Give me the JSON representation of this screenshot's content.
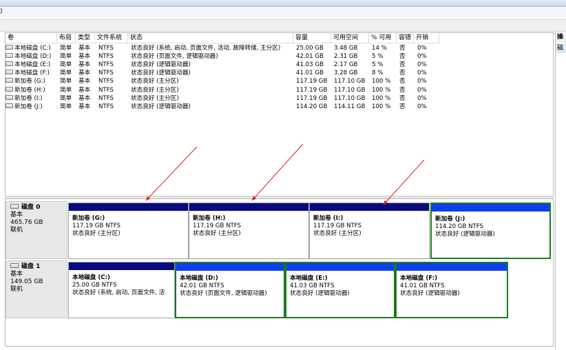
{
  "menu": {
    "first": ")"
  },
  "right_panel": {
    "header": "操作",
    "item": "磁"
  },
  "columns": [
    "卷",
    "布局",
    "类型",
    "文件系统",
    "状态",
    "容量",
    "可用空间",
    "% 可用",
    "容错",
    "开销"
  ],
  "volumes": [
    {
      "name": "本地磁盘 (C:)",
      "layout": "简单",
      "type": "基本",
      "fs": "NTFS",
      "status": "状态良好 (系统, 启动, 页面文件, 活动, 故障转储, 主分区)",
      "capacity": "25.00 GB",
      "free": "3.48 GB",
      "pct": "14 %",
      "fault": "否",
      "overhead": "0%"
    },
    {
      "name": "本地磁盘 (D:)",
      "layout": "简单",
      "type": "基本",
      "fs": "NTFS",
      "status": "状态良好 (页面文件, 逻辑驱动器)",
      "capacity": "42.01 GB",
      "free": "2.31 GB",
      "pct": "5 %",
      "fault": "否",
      "overhead": "0%"
    },
    {
      "name": "本地磁盘 (E:)",
      "layout": "简单",
      "type": "基本",
      "fs": "NTFS",
      "status": "状态良好 (逻辑驱动器)",
      "capacity": "41.03 GB",
      "free": "2.17 GB",
      "pct": "5 %",
      "fault": "否",
      "overhead": "0%"
    },
    {
      "name": "本地磁盘 (F:)",
      "layout": "简单",
      "type": "基本",
      "fs": "NTFS",
      "status": "状态良好 (逻辑驱动器)",
      "capacity": "41.01 GB",
      "free": "3.28 GB",
      "pct": "8 %",
      "fault": "否",
      "overhead": "0%"
    },
    {
      "name": "新加卷 (G:)",
      "layout": "简单",
      "type": "基本",
      "fs": "NTFS",
      "status": "状态良好 (主分区)",
      "capacity": "117.19 GB",
      "free": "117.10 GB",
      "pct": "100 %",
      "fault": "否",
      "overhead": "0%"
    },
    {
      "name": "新加卷 (H:)",
      "layout": "简单",
      "type": "基本",
      "fs": "NTFS",
      "status": "状态良好 (主分区)",
      "capacity": "117.19 GB",
      "free": "117.10 GB",
      "pct": "100 %",
      "fault": "否",
      "overhead": "0%"
    },
    {
      "name": "新加卷 (I:)",
      "layout": "简单",
      "type": "基本",
      "fs": "NTFS",
      "status": "状态良好 (主分区)",
      "capacity": "117.19 GB",
      "free": "117.10 GB",
      "pct": "100 %",
      "fault": "否",
      "overhead": "0%"
    },
    {
      "name": "新加卷 (J:)",
      "layout": "简单",
      "type": "基本",
      "fs": "NTFS",
      "status": "状态良好 (逻辑驱动器)",
      "capacity": "114.20 GB",
      "free": "114.11 GB",
      "pct": "100 %",
      "fault": "否",
      "overhead": "0%"
    }
  ],
  "disks": [
    {
      "name": "磁盘 0",
      "kind": "基本",
      "size": "465.76 GB",
      "state": "联机",
      "partitions": [
        {
          "title": "新加卷  (G:)",
          "size": "117.19 GB NTFS",
          "status": "状态良好 (主分区)",
          "bar": "primary",
          "selected": false
        },
        {
          "title": "新加卷  (H:)",
          "size": "117.19 GB NTFS",
          "status": "状态良好 (主分区)",
          "bar": "primary",
          "selected": false
        },
        {
          "title": "新加卷  (I:)",
          "size": "117.19 GB NTFS",
          "status": "状态良好 (主分区)",
          "bar": "primary",
          "selected": false
        },
        {
          "title": "新加卷  (J:)",
          "size": "114.20 GB NTFS",
          "status": "状态良好 (逻辑驱动器)",
          "bar": "logical",
          "selected": true
        }
      ]
    },
    {
      "name": "磁盘 1",
      "kind": "基本",
      "size": "149.05 GB",
      "state": "联机",
      "partitions": [
        {
          "title": "本地磁盘  (C:)",
          "size": "25.00 GB NTFS",
          "status": "状态良好 (系统, 启动, 页面文件, 活",
          "bar": "primary",
          "selected": false
        },
        {
          "title": "本地磁盘  (D:)",
          "size": "42.01 GB NTFS",
          "status": "状态良好 (页面文件, 逻辑驱动器)",
          "bar": "logical",
          "selected": true
        },
        {
          "title": "本地磁盘  (E:)",
          "size": "41.03 GB NTFS",
          "status": "状态良好 (逻辑驱动器)",
          "bar": "logical",
          "selected": true
        },
        {
          "title": "本地磁盘  (F:)",
          "size": "41.01 GB NTFS",
          "status": "状态良好 (逻辑驱动器)",
          "bar": "logical",
          "selected": true
        }
      ]
    }
  ],
  "colors": {
    "primary_bar": "#0a0a80",
    "logical_bar": "#0f3ff0",
    "selection": "#1b7a1b",
    "annotation_arrow": "#e02020"
  }
}
